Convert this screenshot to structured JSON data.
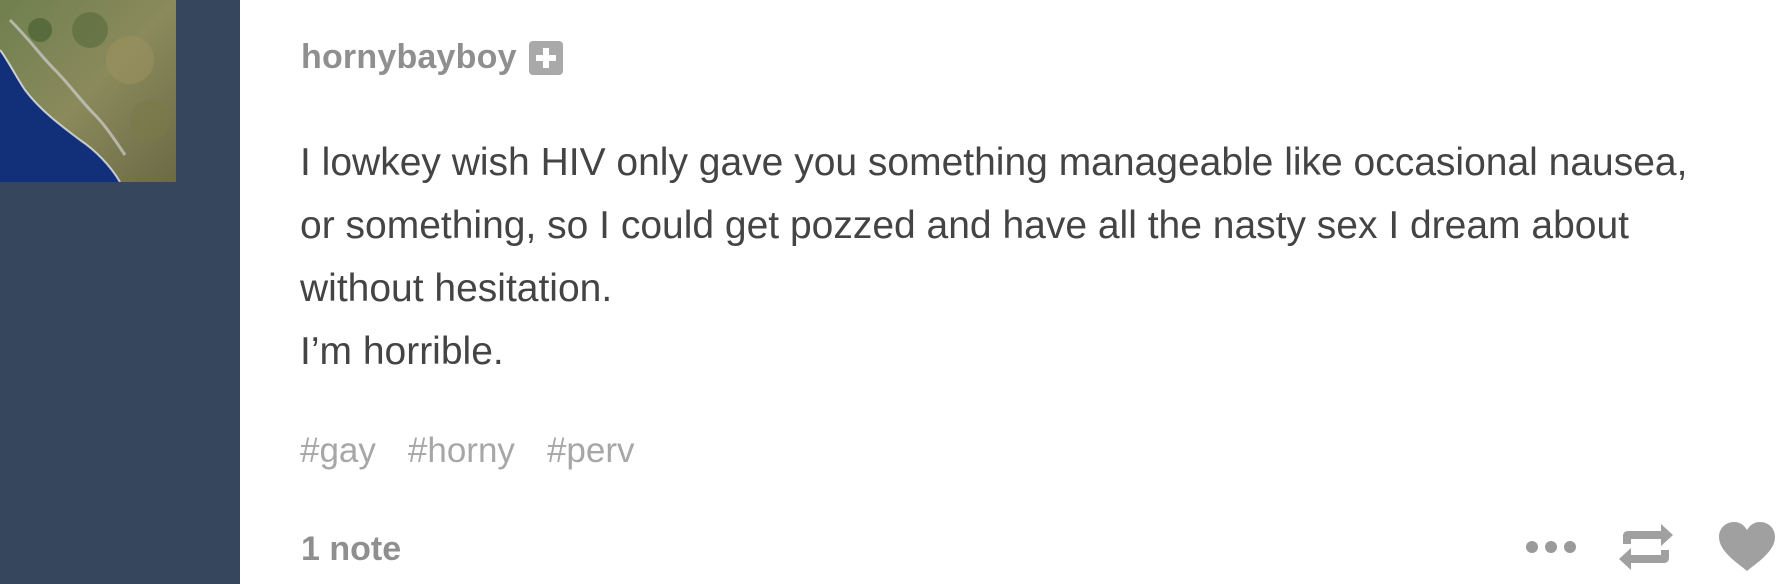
{
  "post": {
    "username": "hornybayboy",
    "body_lines": [
      "I lowkey wish HIV only gave you something manageable like occasional nausea,",
      "or something, so I could get pozzed and have all the nasty sex I dream about",
      "without hesitation.",
      "I’m horrible."
    ],
    "tags": [
      "#gay",
      "#horny",
      "#perv"
    ],
    "notes": "1 note",
    "icons": {
      "follow": "follow-plus-icon",
      "more": "more-dots-icon",
      "reblog": "reblog-icon",
      "like": "heart-icon"
    }
  }
}
